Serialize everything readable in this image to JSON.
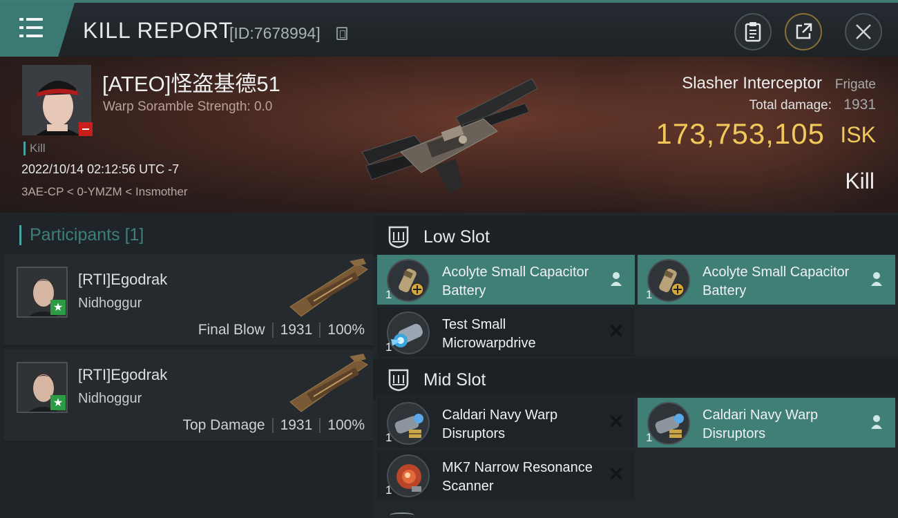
{
  "header": {
    "title": "KILL REPORT",
    "report_id": "[ID:7678994]",
    "icons": [
      "menu-icon",
      "copy-icon",
      "clipboard-icon",
      "share-icon",
      "close-icon"
    ]
  },
  "victim": {
    "name": "[ATEO]怪盗基德51",
    "scramble": "Warp Soramble Strength: 0.0",
    "tag": "Kill",
    "date": "2022/10/14 02:12:56 UTC -7",
    "location": "3AE-CP < 0-YMZM < Insmother",
    "ship_name": "Slasher Interceptor",
    "ship_class": "Frigate",
    "damage_label": "Total damage:",
    "damage_value": "1931",
    "isk_value": "173,753,105",
    "isk_unit": "ISK",
    "result": "Kill"
  },
  "participants": {
    "title": "Participants",
    "count": "[1]",
    "items": [
      {
        "name": "[RTI]Egodrak",
        "ship": "Nidhoggur",
        "role": "Final Blow",
        "damage": "1931",
        "percent": "100%"
      },
      {
        "name": "[RTI]Egodrak",
        "ship": "Nidhoggur",
        "role": "Top Damage",
        "damage": "1931",
        "percent": "100%"
      }
    ]
  },
  "fitting": {
    "low_slot": {
      "title": "Low Slot",
      "modules": [
        {
          "name": "Acolyte Small Capacitor Battery",
          "qty": "1",
          "status": "dropped"
        },
        {
          "name": "Acolyte Small Capacitor Battery",
          "qty": "1",
          "status": "dropped"
        },
        {
          "name": "Test Small Microwarpdrive",
          "qty": "1",
          "status": "destroyed"
        }
      ]
    },
    "mid_slot": {
      "title": "Mid Slot",
      "modules": [
        {
          "name": "Caldari Navy Warp Disruptors",
          "qty": "1",
          "status": "destroyed"
        },
        {
          "name": "Caldari Navy Warp Disruptors",
          "qty": "1",
          "status": "dropped"
        },
        {
          "name": "MK7 Narrow Resonance Scanner",
          "qty": "1",
          "status": "destroyed"
        }
      ]
    }
  },
  "colors": {
    "accent": "#3f7f75",
    "isk": "#f0c95a",
    "kill_badge": "#c81e1e",
    "star_badge": "#2d9a45"
  }
}
